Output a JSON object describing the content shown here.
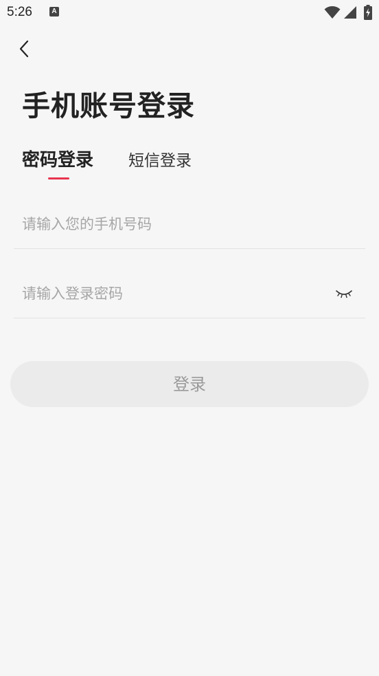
{
  "status_bar": {
    "time": "5:26",
    "notification_icon": "A",
    "icons": [
      "wifi-icon",
      "signal-icon",
      "battery-charging-icon"
    ]
  },
  "nav": {
    "back_icon": "chevron-left-icon"
  },
  "page": {
    "title": "手机账号登录"
  },
  "tabs": [
    {
      "label": "密码登录",
      "active": true
    },
    {
      "label": "短信登录",
      "active": false
    }
  ],
  "form": {
    "phone_placeholder": "请输入您的手机号码",
    "phone_value": "",
    "password_placeholder": "请输入登录密码",
    "password_value": "",
    "password_toggle_icon": "eye-closed-icon",
    "submit_label": "登录"
  },
  "colors": {
    "background": "#f6f6f6",
    "accent": "#e8344e",
    "button_bg": "#ebebeb",
    "button_text": "#9a9a9a",
    "placeholder": "#a6a6a6"
  }
}
